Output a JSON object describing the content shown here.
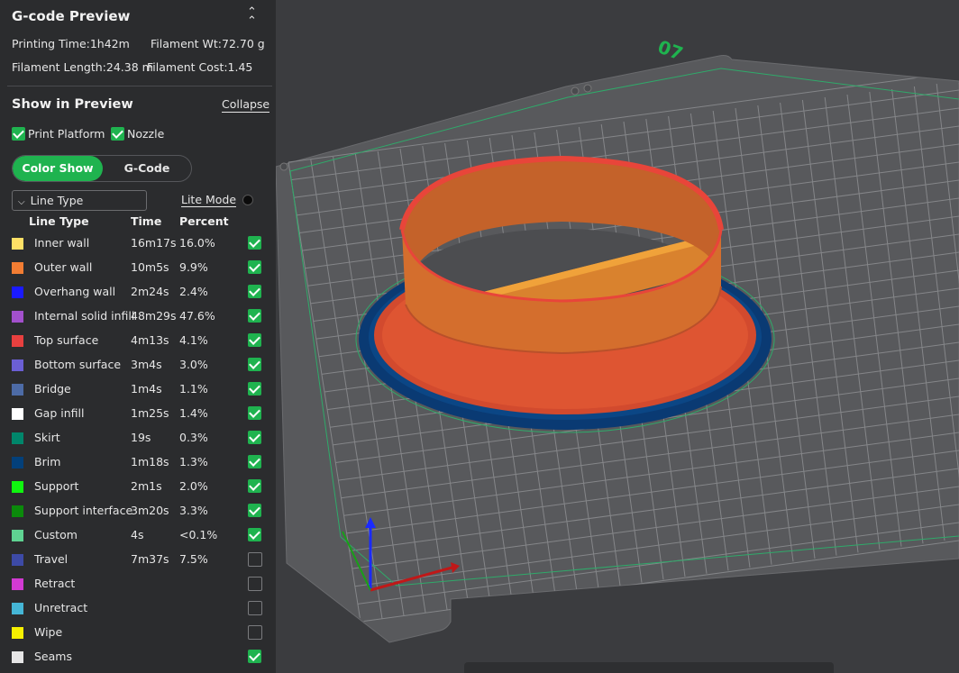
{
  "header": {
    "title": "G-code Preview"
  },
  "stats": {
    "printing_time": "Printing Time:1h42m",
    "filament_wt": "Filament Wt:72.70 g",
    "filament_length": "Filament Length:24.38 m",
    "filament_cost": "Filament Cost:1.45"
  },
  "show_in_preview": {
    "title": "Show in Preview",
    "collapse_label": "Collapse",
    "print_platform_label": "Print Platform",
    "print_platform_checked": true,
    "nozzle_label": "Nozzle",
    "nozzle_checked": true
  },
  "mode_tabs": {
    "color_show": "Color Show",
    "gcode": "G-Code",
    "active": "Color Show"
  },
  "line_type_dropdown": {
    "selected": "Line Type"
  },
  "lite_mode_label": "Lite Mode",
  "table": {
    "headers": {
      "line_type": "Line Type",
      "time": "Time",
      "percent": "Percent"
    },
    "rows": [
      {
        "name": "Inner wall",
        "time": "16m17s",
        "percent": "16.0%",
        "color": "#ffe066",
        "checked": true
      },
      {
        "name": "Outer wall",
        "time": "10m5s",
        "percent": "9.9%",
        "color": "#f27d33",
        "checked": true
      },
      {
        "name": "Overhang wall",
        "time": "2m24s",
        "percent": "2.4%",
        "color": "#1a1aff",
        "checked": true
      },
      {
        "name": "Internal solid infill",
        "time": "48m29s",
        "percent": "47.6%",
        "color": "#a250cc",
        "checked": true
      },
      {
        "name": "Top surface",
        "time": "4m13s",
        "percent": "4.1%",
        "color": "#e8403f",
        "checked": true
      },
      {
        "name": "Bottom surface",
        "time": "3m4s",
        "percent": "3.0%",
        "color": "#6b5fd4",
        "checked": true
      },
      {
        "name": "Bridge",
        "time": "1m4s",
        "percent": "1.1%",
        "color": "#4d6ba6",
        "checked": true
      },
      {
        "name": "Gap infill",
        "time": "1m25s",
        "percent": "1.4%",
        "color": "#ffffff",
        "checked": true
      },
      {
        "name": "Skirt",
        "time": "19s",
        "percent": "0.3%",
        "color": "#00866b",
        "checked": true
      },
      {
        "name": "Brim",
        "time": "1m18s",
        "percent": "1.3%",
        "color": "#03407a",
        "checked": true
      },
      {
        "name": "Support",
        "time": "2m1s",
        "percent": "2.0%",
        "color": "#10f50f",
        "checked": true
      },
      {
        "name": "Support interface",
        "time": "3m20s",
        "percent": "3.3%",
        "color": "#0b8a0b",
        "checked": true
      },
      {
        "name": "Custom",
        "time": "4s",
        "percent": "<0.1%",
        "color": "#5fd392",
        "checked": true
      },
      {
        "name": "Travel",
        "time": "7m37s",
        "percent": "7.5%",
        "color": "#3d4aa6",
        "checked": false
      },
      {
        "name": "Retract",
        "time": "",
        "percent": "",
        "color": "#d23ad3",
        "checked": false
      },
      {
        "name": "Unretract",
        "time": "",
        "percent": "",
        "color": "#45b6d6",
        "checked": false
      },
      {
        "name": "Wipe",
        "time": "",
        "percent": "",
        "color": "#f7f000",
        "checked": false
      },
      {
        "name": "Seams",
        "time": "",
        "percent": "",
        "color": "#e6e6e6",
        "checked": true
      }
    ]
  },
  "plate": {
    "label": "07",
    "label_color": "#1fb34f"
  },
  "colors": {
    "accent": "#1fb34f",
    "panel_bg": "#2b2c2e",
    "viewport_bg": "#3b3c3f"
  }
}
